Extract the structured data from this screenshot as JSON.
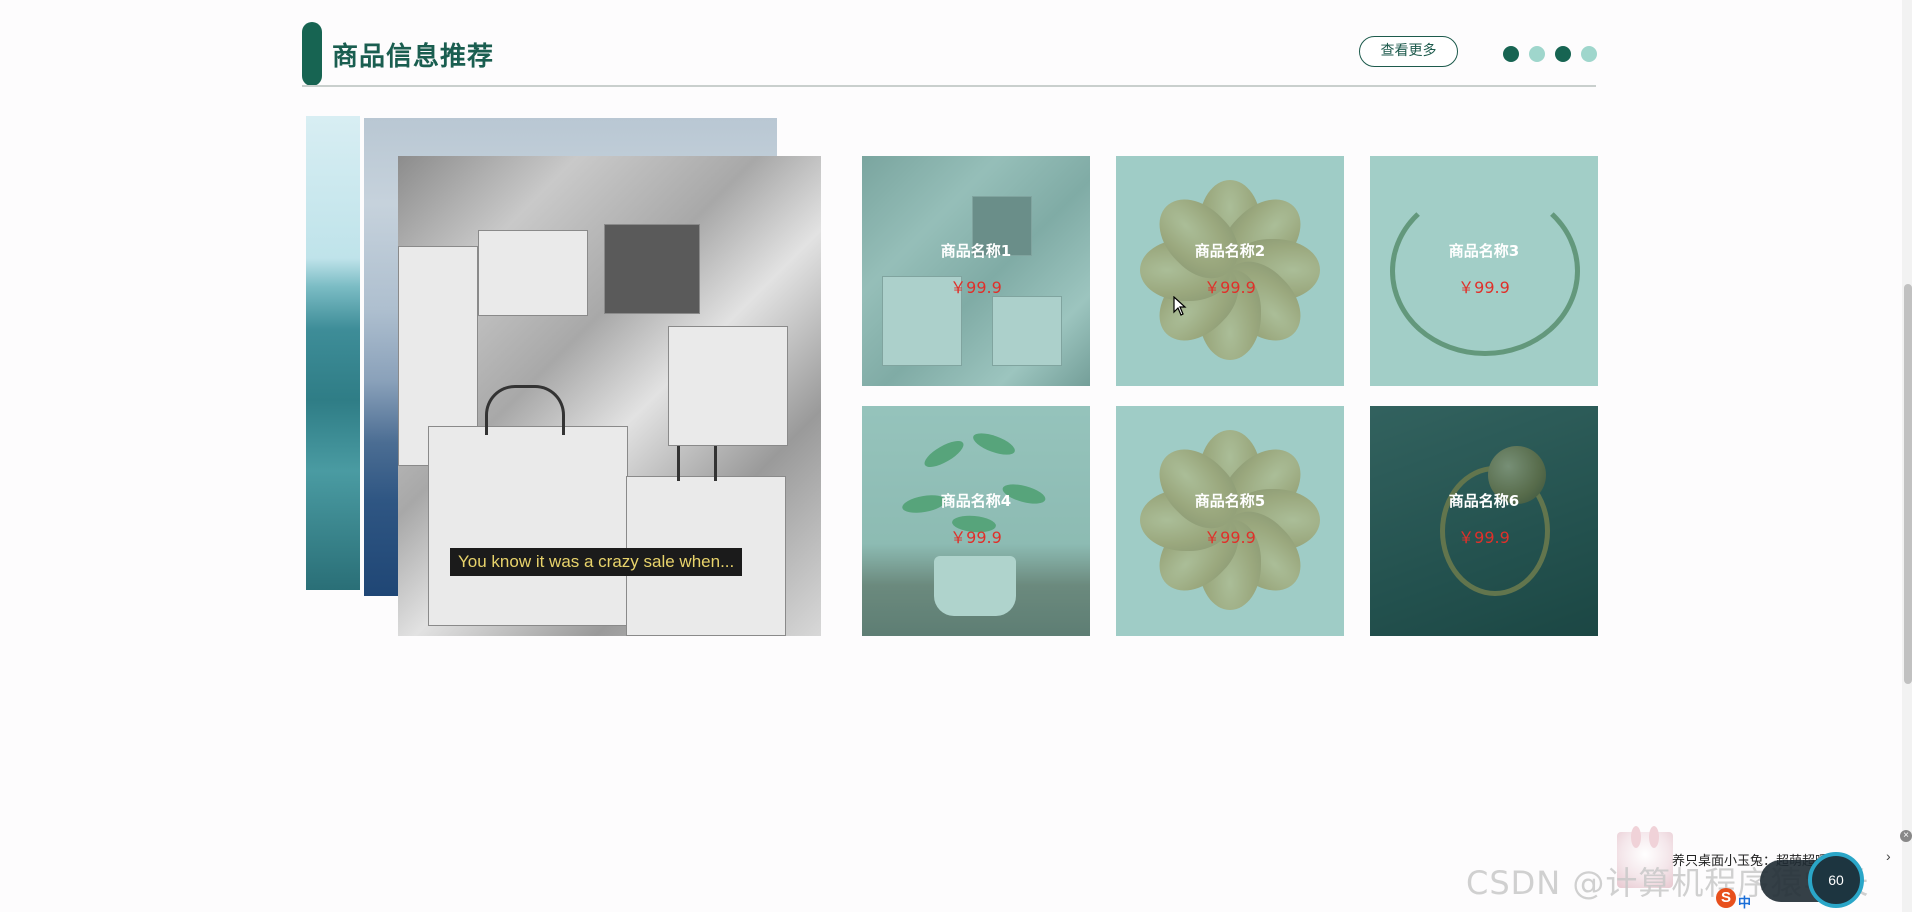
{
  "section": {
    "title": "商品信息推荐",
    "more_label": "查看更多",
    "indicator_dots": [
      "dark",
      "light",
      "dark",
      "light"
    ]
  },
  "carousel": {
    "caption": "You know it was a crazy sale when..."
  },
  "products": [
    {
      "name": "商品名称1",
      "price": "￥99.9"
    },
    {
      "name": "商品名称2",
      "price": "￥99.9"
    },
    {
      "name": "商品名称3",
      "price": "￥99.9"
    },
    {
      "name": "商品名称4",
      "price": "￥99.9"
    },
    {
      "name": "商品名称5",
      "price": "￥99.9"
    },
    {
      "name": "商品名称6",
      "price": "￥99.9"
    }
  ],
  "overlay": {
    "notice_text": "养只桌面小玉兔：超萌超暖萌",
    "watermark": "CSDN @计算机程序猿学长",
    "speed_value": "60",
    "ime_label": "中"
  },
  "colors": {
    "accent": "#176452",
    "accent_light": "#9fd6cc",
    "price": "#e0302a",
    "header_line": "#c9cfcd"
  }
}
